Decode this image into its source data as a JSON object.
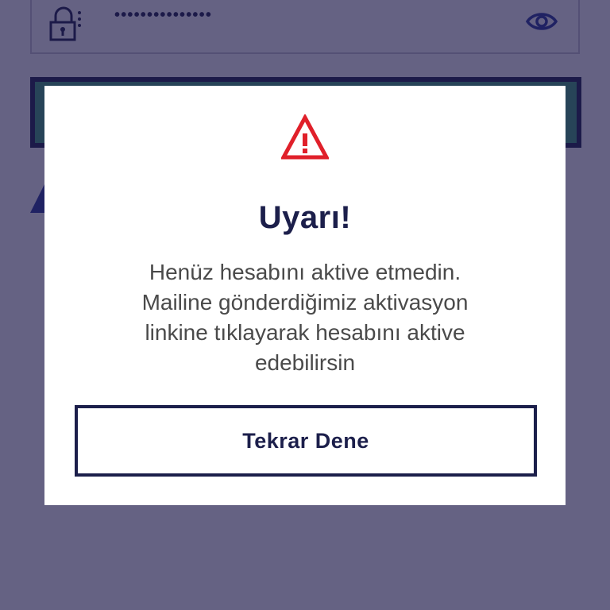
{
  "login": {
    "password_masked": "•••••••••••••••",
    "icons": {
      "lock": "lock-icon",
      "eye": "eye-icon"
    }
  },
  "dialog": {
    "icon": "warning-triangle-icon",
    "title": "Uyarı!",
    "message_lines": [
      "Henüz hesabını aktive etmedin.",
      "Mailine gönderdiğimiz aktivasyon",
      "linkine tıklayarak hesabını aktive",
      "edebilirsin"
    ],
    "button_label": "Tekrar Dene"
  },
  "colors": {
    "brand_navy": "#1c1f4b",
    "login_green": "#3fa37b",
    "warning_red": "#e0202a",
    "overlay": "#615c7e"
  }
}
